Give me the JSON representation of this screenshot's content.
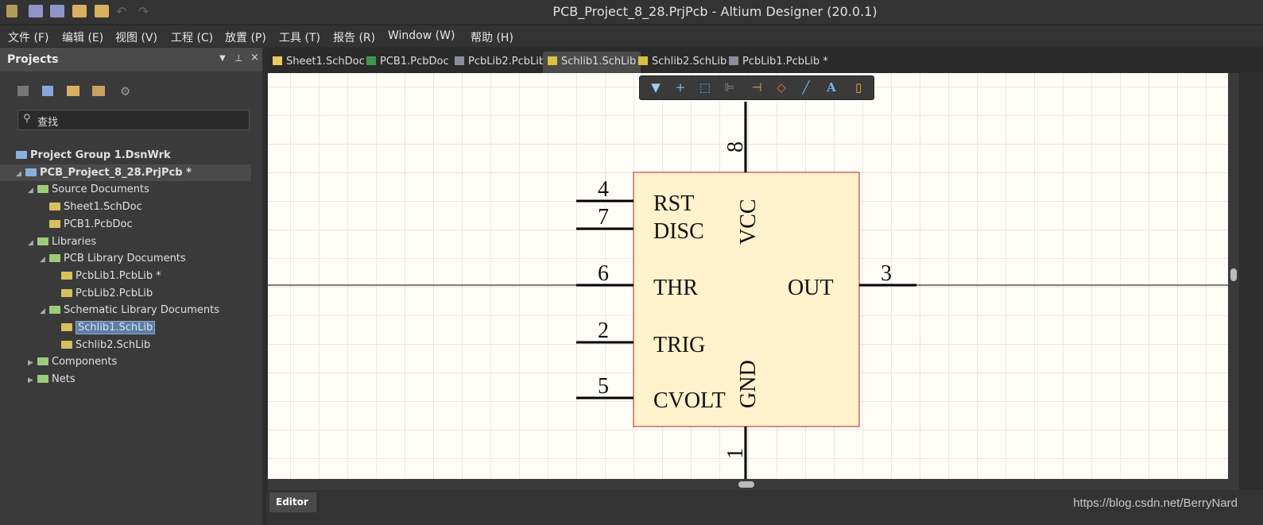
{
  "window": {
    "title": "PCB_Project_8_28.PrjPcb - Altium Designer (20.0.1)"
  },
  "quick_toolbar": [
    "app-logo-icon",
    "save-icon",
    "save-all-icon",
    "open-icon",
    "open-project-icon",
    "undo-icon",
    "redo-icon"
  ],
  "menu": [
    "文件 (F)",
    "编辑 (E)",
    "视图 (V)",
    "工程 (C)",
    "放置 (P)",
    "工具 (T)",
    "报告 (R)",
    "Window (W)",
    "帮助 (H)"
  ],
  "projects_panel": {
    "title": "Projects",
    "search_placeholder": "查找",
    "tree": [
      {
        "label": "Project Group 1.DsnWrk",
        "level": 0,
        "bold": true
      },
      {
        "label": "PCB_Project_8_28.PrjPcb *",
        "level": 0,
        "bold": true,
        "expanded": true
      },
      {
        "label": "Source Documents",
        "level": 1,
        "folder": true,
        "expanded": true
      },
      {
        "label": "Sheet1.SchDoc",
        "level": 2
      },
      {
        "label": "PCB1.PcbDoc",
        "level": 2
      },
      {
        "label": "Libraries",
        "level": 1,
        "folder": true,
        "expanded": true
      },
      {
        "label": "PCB Library Documents",
        "level": 2,
        "folder": true,
        "expanded": true
      },
      {
        "label": "PcbLib1.PcbLib *",
        "level": 3
      },
      {
        "label": "PcbLib2.PcbLib",
        "level": 3
      },
      {
        "label": "Schematic Library Documents",
        "level": 2,
        "folder": true,
        "expanded": true
      },
      {
        "label": "Schlib1.SchLib",
        "level": 3,
        "selected": true
      },
      {
        "label": "Schlib2.SchLib",
        "level": 3
      },
      {
        "label": "Components",
        "level": 1,
        "folder": true,
        "expanded": false
      },
      {
        "label": "Nets",
        "level": 1,
        "folder": true,
        "expanded": false
      }
    ]
  },
  "tabs": [
    {
      "label": "Sheet1.SchDoc"
    },
    {
      "label": "PCB1.PcbDoc"
    },
    {
      "label": "PcbLib2.PcbLib"
    },
    {
      "label": "Schlib1.SchLib",
      "active": true
    },
    {
      "label": "Schlib2.SchLib"
    },
    {
      "label": "PcbLib1.PcbLib *"
    }
  ],
  "component": {
    "body_fill": "#fff2cc",
    "body_border": "#b22222",
    "pins": [
      {
        "number": "4",
        "name": "RST"
      },
      {
        "number": "7",
        "name": "DISC"
      },
      {
        "number": "6",
        "name": "THR"
      },
      {
        "number": "2",
        "name": "TRIG"
      },
      {
        "number": "5",
        "name": "CVOLT"
      },
      {
        "number": "3",
        "name": "OUT"
      },
      {
        "number": "8",
        "name": "VCC"
      },
      {
        "number": "1",
        "name": "GND"
      }
    ]
  },
  "bottom": {
    "editor_tab": "Editor",
    "watermark": "https://blog.csdn.net/BerryNard"
  }
}
